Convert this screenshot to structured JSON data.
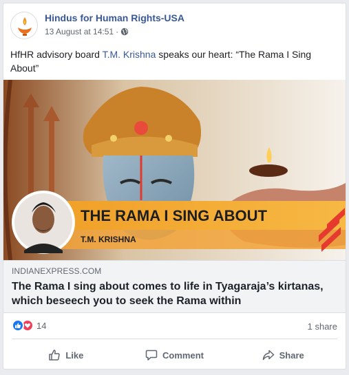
{
  "post": {
    "page_name": "Hindus for Human Rights-USA",
    "timestamp": "13 August at 14:51",
    "separator": "·",
    "privacy_icon": "globe-icon",
    "text_before": "HfHR advisory board ",
    "mention": "T.M. Krishna",
    "text_after": " speaks our heart: “The Rama I Sing About”"
  },
  "link": {
    "banner_title": "THE RAMA I SING ABOUT",
    "banner_author": "T.M. KRISHNA",
    "domain": "INDIANEXPRESS.COM",
    "title": "The Rama I sing about comes to life in Tyagaraja’s kirtanas, which beseech you to seek the Rama within"
  },
  "engagement": {
    "reaction_count": "14",
    "shares": "1 share"
  },
  "actions": {
    "like": "Like",
    "comment": "Comment",
    "share": "Share"
  },
  "colors": {
    "link_blue": "#385898",
    "banner_orange": "#f4a62a",
    "like_blue": "#1877f2",
    "love_red": "#f33e58",
    "brand_red": "#e63a2e"
  }
}
